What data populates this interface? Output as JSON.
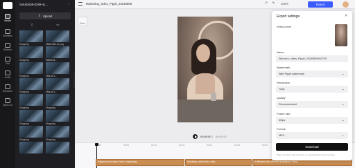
{
  "left_rail": {
    "items": [
      {
        "label": "Media",
        "icon": "media-icon"
      },
      {
        "label": "Elements",
        "icon": "shapes-icon"
      },
      {
        "label": "Stickers",
        "icon": "sticker-icon"
      },
      {
        "label": "Text",
        "icon": "text-icon"
      },
      {
        "label": "Audio",
        "icon": "audio-icon"
      },
      {
        "label": "Elements",
        "icon": "elements-icon"
      },
      {
        "label": "Quick cut",
        "icon": "scissors-icon"
      }
    ]
  },
  "media_panel": {
    "title": "SoloBlob8-0289-4c...",
    "upload_label": "Upload",
    "thumb_captions": [
      "Shopping",
      "hf65e2b5e-e1.png",
      "Shopping",
      "f5a5d234...",
      "Shopping",
      "hf5a1a71...",
      "Shopping",
      "hf5a1a71...",
      "Shopping",
      "Shopping",
      "Shopping",
      "Shopping",
      "Shopping",
      "Shopping"
    ]
  },
  "topbar": {
    "project_name": "Marketing_video_Pippit_20240809",
    "zoom": "100%",
    "export_label": "Export"
  },
  "stage": {
    "tool_label": "Ratio"
  },
  "player": {
    "current_time": "00:00:00",
    "separator": "/",
    "total_time": "00:00:40"
  },
  "timeline": {
    "ruler": [
      "00:00",
      "00:05",
      "00:10",
      "00:15",
      "00:20",
      "00:25",
      "00:30",
      "00:35",
      "00:40"
    ],
    "clips": [
      "Elegance and charm, fresh, invigorating...",
      "Hydrating, radiant skin, daily...",
      "A difference has one with a gorgeous, finely..."
    ]
  },
  "export_settings": {
    "title": "Export settings",
    "video_cover_label": "Video cover",
    "name_label": "Name",
    "name_value": "Skincare_video_Pippit_20240809042725",
    "watermark_label": "Watermark",
    "watermark_value": "With Pippit watermark",
    "resolution_label": "Resolution",
    "resolution_value": "720p",
    "quality_label": "Quality",
    "quality_value": "Recommended",
    "frame_rate_label": "Frame rate",
    "frame_rate_value": "30fps",
    "format_label": "Format",
    "format_value": "MP4",
    "download_label": "Download",
    "note": "Pippit and Sora will not grace on stream/sales recommended"
  }
}
